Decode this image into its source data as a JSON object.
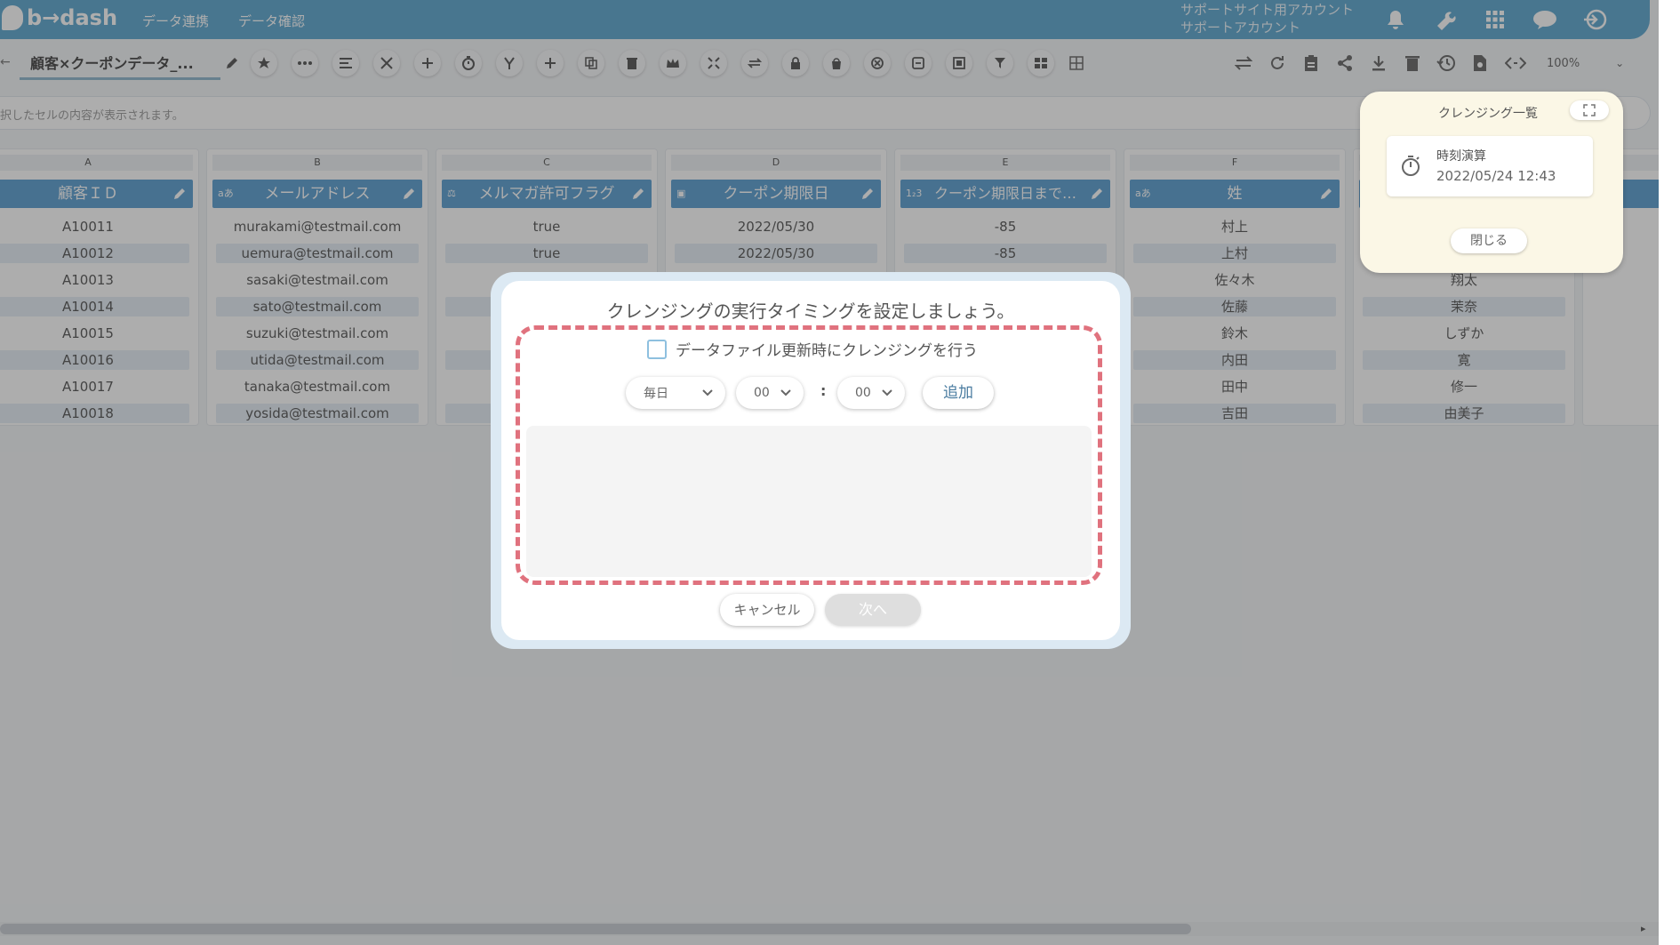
{
  "header": {
    "logo": "b→dash",
    "nav": [
      "データ連携",
      "データ確認"
    ],
    "account_line1": "サポートサイト用アカウント",
    "account_line2": "サポートアカウント"
  },
  "toolbar": {
    "title": "顧客×クーポンデータ_...",
    "zoom": "100%"
  },
  "formula_bar": {
    "placeholder": "択したセルの内容が表示されます。"
  },
  "grid": {
    "columns": [
      {
        "letter": "A",
        "header": "顧客ＩＤ",
        "type_tag": "",
        "cells": [
          "A10011",
          "A10012",
          "A10013",
          "A10014",
          "A10015",
          "A10016",
          "A10017",
          "A10018"
        ]
      },
      {
        "letter": "B",
        "header": "メールアドレス",
        "type_tag": "aあ",
        "cells": [
          "murakami@testmail.com",
          "uemura@testmail.com",
          "sasaki@testmail.com",
          "sato@testmail.com",
          "suzuki@testmail.com",
          "utida@testmail.com",
          "tanaka@testmail.com",
          "yosida@testmail.com"
        ]
      },
      {
        "letter": "C",
        "header": "メルマガ許可フラグ",
        "type_tag": "⚖",
        "cells": [
          "true",
          "true",
          "",
          "",
          "",
          "",
          "",
          ""
        ]
      },
      {
        "letter": "D",
        "header": "クーポン期限日",
        "type_tag": "▣",
        "cells": [
          "2022/05/30",
          "2022/05/30",
          "",
          "",
          "",
          "",
          "",
          ""
        ]
      },
      {
        "letter": "E",
        "header": "クーポン期限日まで…",
        "type_tag": "1₂3",
        "cells": [
          "-85",
          "-85",
          "",
          "",
          "",
          "",
          "",
          ""
        ]
      },
      {
        "letter": "F",
        "header": "姓",
        "type_tag": "aあ",
        "cells": [
          "村上",
          "上村",
          "佐々木",
          "佐藤",
          "鈴木",
          "内田",
          "田中",
          "吉田"
        ]
      },
      {
        "letter": "",
        "header": "",
        "type_tag": "",
        "cells": [
          "",
          "",
          "翔太",
          "茉奈",
          "しずか",
          "寛",
          "修一",
          "由美子"
        ]
      }
    ]
  },
  "cleansing_panel": {
    "title": "クレンジング一覧",
    "item_title": "時刻演算",
    "item_date": "2022/05/24 12:43",
    "close_label": "閉じる"
  },
  "modal": {
    "title": "クレンジングの実行タイミングを設定しましょう。",
    "checkbox_label": "データファイル更新時にクレンジングを行う",
    "frequency": "毎日",
    "hour": "00",
    "colon": ":",
    "minute": "00",
    "add_label": "追加",
    "cancel_label": "キャンセル",
    "next_label": "次へ"
  },
  "colors": {
    "header_bg": "#5da6cf",
    "column_header": "#5b9fd1",
    "dashed_highlight": "#e0727e",
    "panel_bg": "#fbf7e6"
  },
  "icons": [
    "bell-icon",
    "wrench-icon",
    "grid-icon",
    "chat-icon",
    "logout-icon",
    "pencil-icon",
    "star-icon",
    "timer-icon",
    "filter-icon",
    "trash-icon",
    "download-icon",
    "share-icon",
    "history-icon",
    "code-icon",
    "expand-icon"
  ]
}
